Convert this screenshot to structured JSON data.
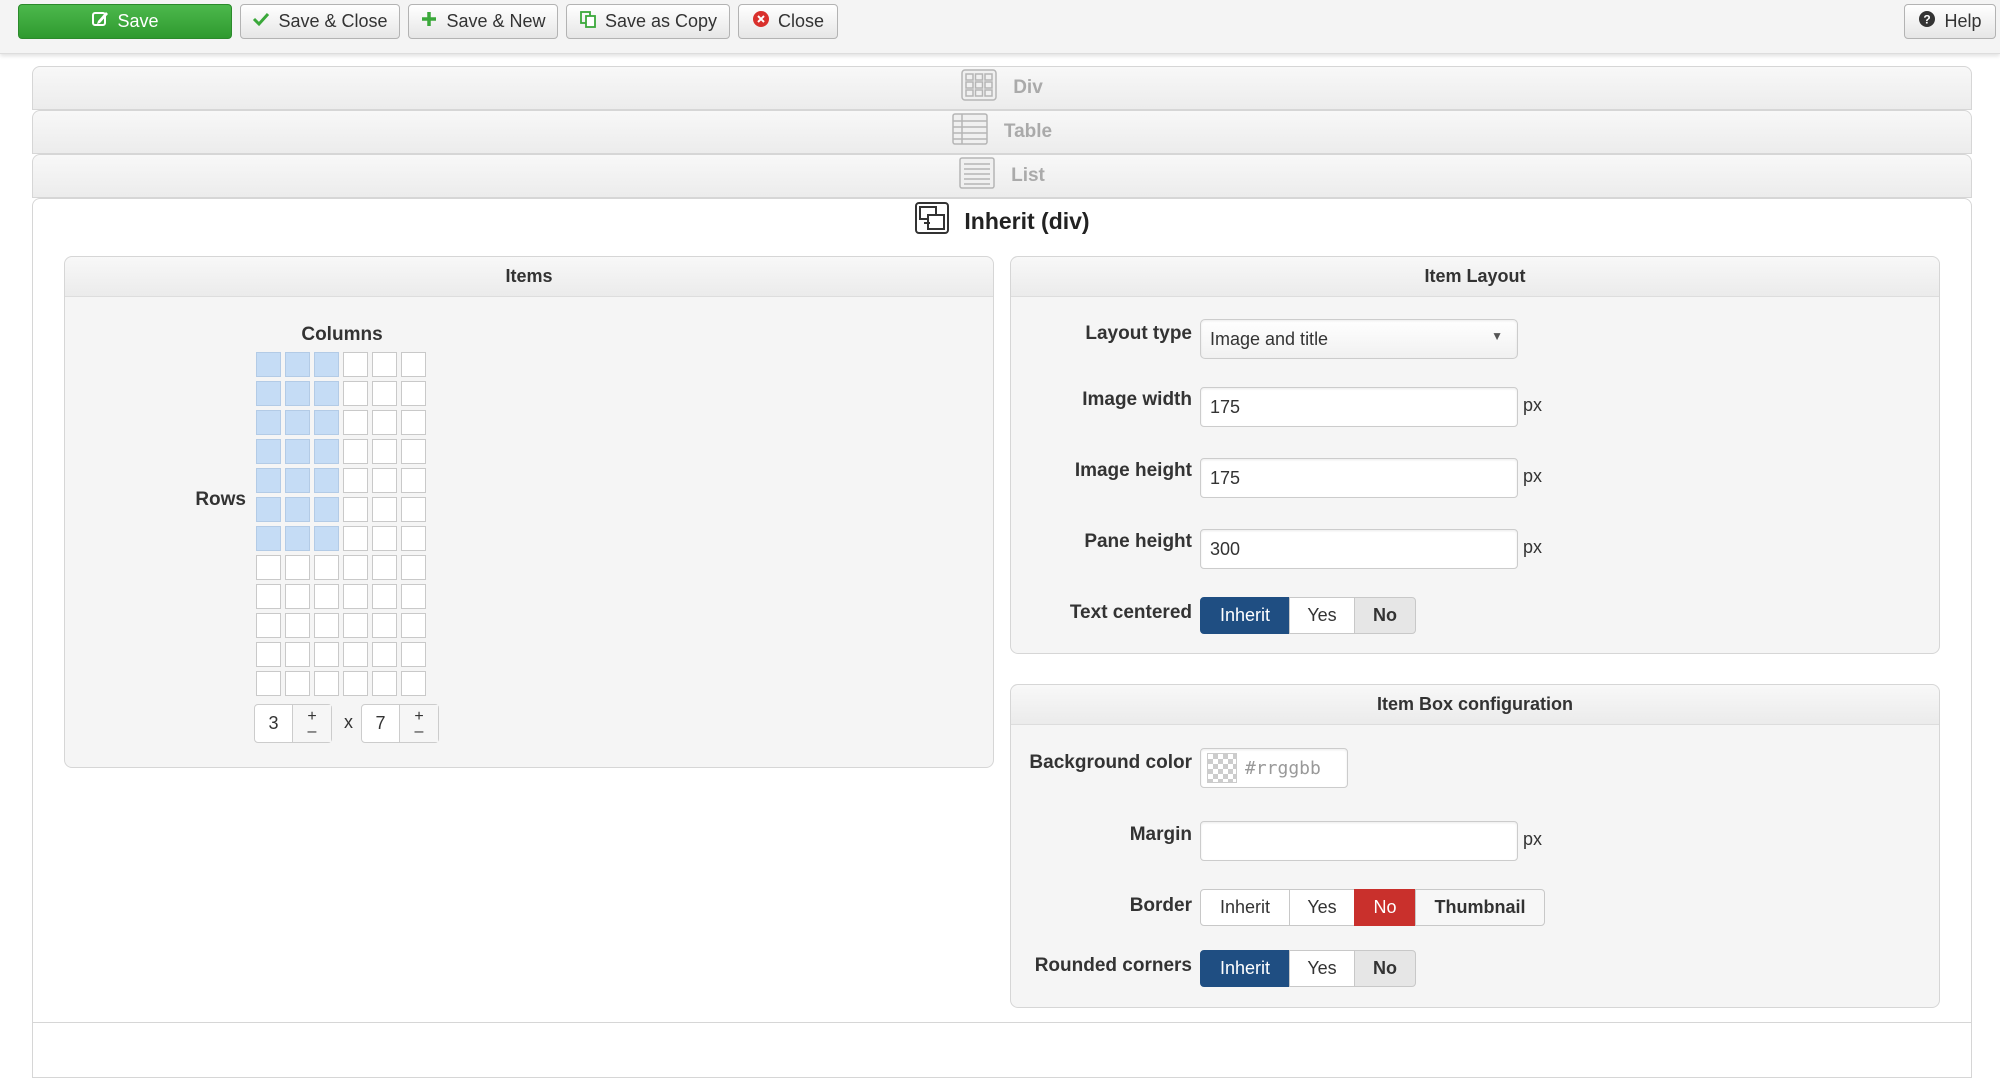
{
  "toolbar": {
    "save": "Save",
    "save_close": "Save & Close",
    "save_new": "Save & New",
    "save_copy": "Save as Copy",
    "close": "Close",
    "help": "Help"
  },
  "accordion": {
    "div": "Div",
    "table": "Table",
    "list": "List",
    "inherit": "Inherit (div)"
  },
  "items": {
    "title": "Items",
    "columns_label": "Columns",
    "rows_label": "Rows",
    "grid_columns_total": 6,
    "grid_rows_total": 12,
    "selected_columns": 3,
    "selected_rows": 7,
    "columns_value": "3",
    "rows_value": "7",
    "times": "x",
    "plus": "+",
    "minus": "–"
  },
  "item_layout": {
    "title": "Item Layout",
    "layout_type_label": "Layout type",
    "layout_type_value": "Image and title",
    "image_width_label": "Image width",
    "image_width_value": "175",
    "image_height_label": "Image height",
    "image_height_value": "175",
    "pane_height_label": "Pane height",
    "pane_height_value": "300",
    "unit": "px",
    "text_centered_label": "Text centered",
    "options": [
      "Inherit",
      "Yes",
      "No"
    ]
  },
  "item_box": {
    "title": "Item Box configuration",
    "background_color_label": "Background color",
    "background_color_placeholder": "#rrggbb",
    "margin_label": "Margin",
    "margin_value": "",
    "unit": "px",
    "border_label": "Border",
    "border_options": [
      "Inherit",
      "Yes",
      "No",
      "Thumbnail"
    ],
    "rounded_label": "Rounded corners",
    "rounded_options": [
      "Inherit",
      "Yes",
      "No"
    ]
  },
  "colors": {
    "save_green": "#3aa83a",
    "active_blue": "#1f4e82",
    "active_red": "#c9302c",
    "grid_selected": "#c5dcf5"
  }
}
